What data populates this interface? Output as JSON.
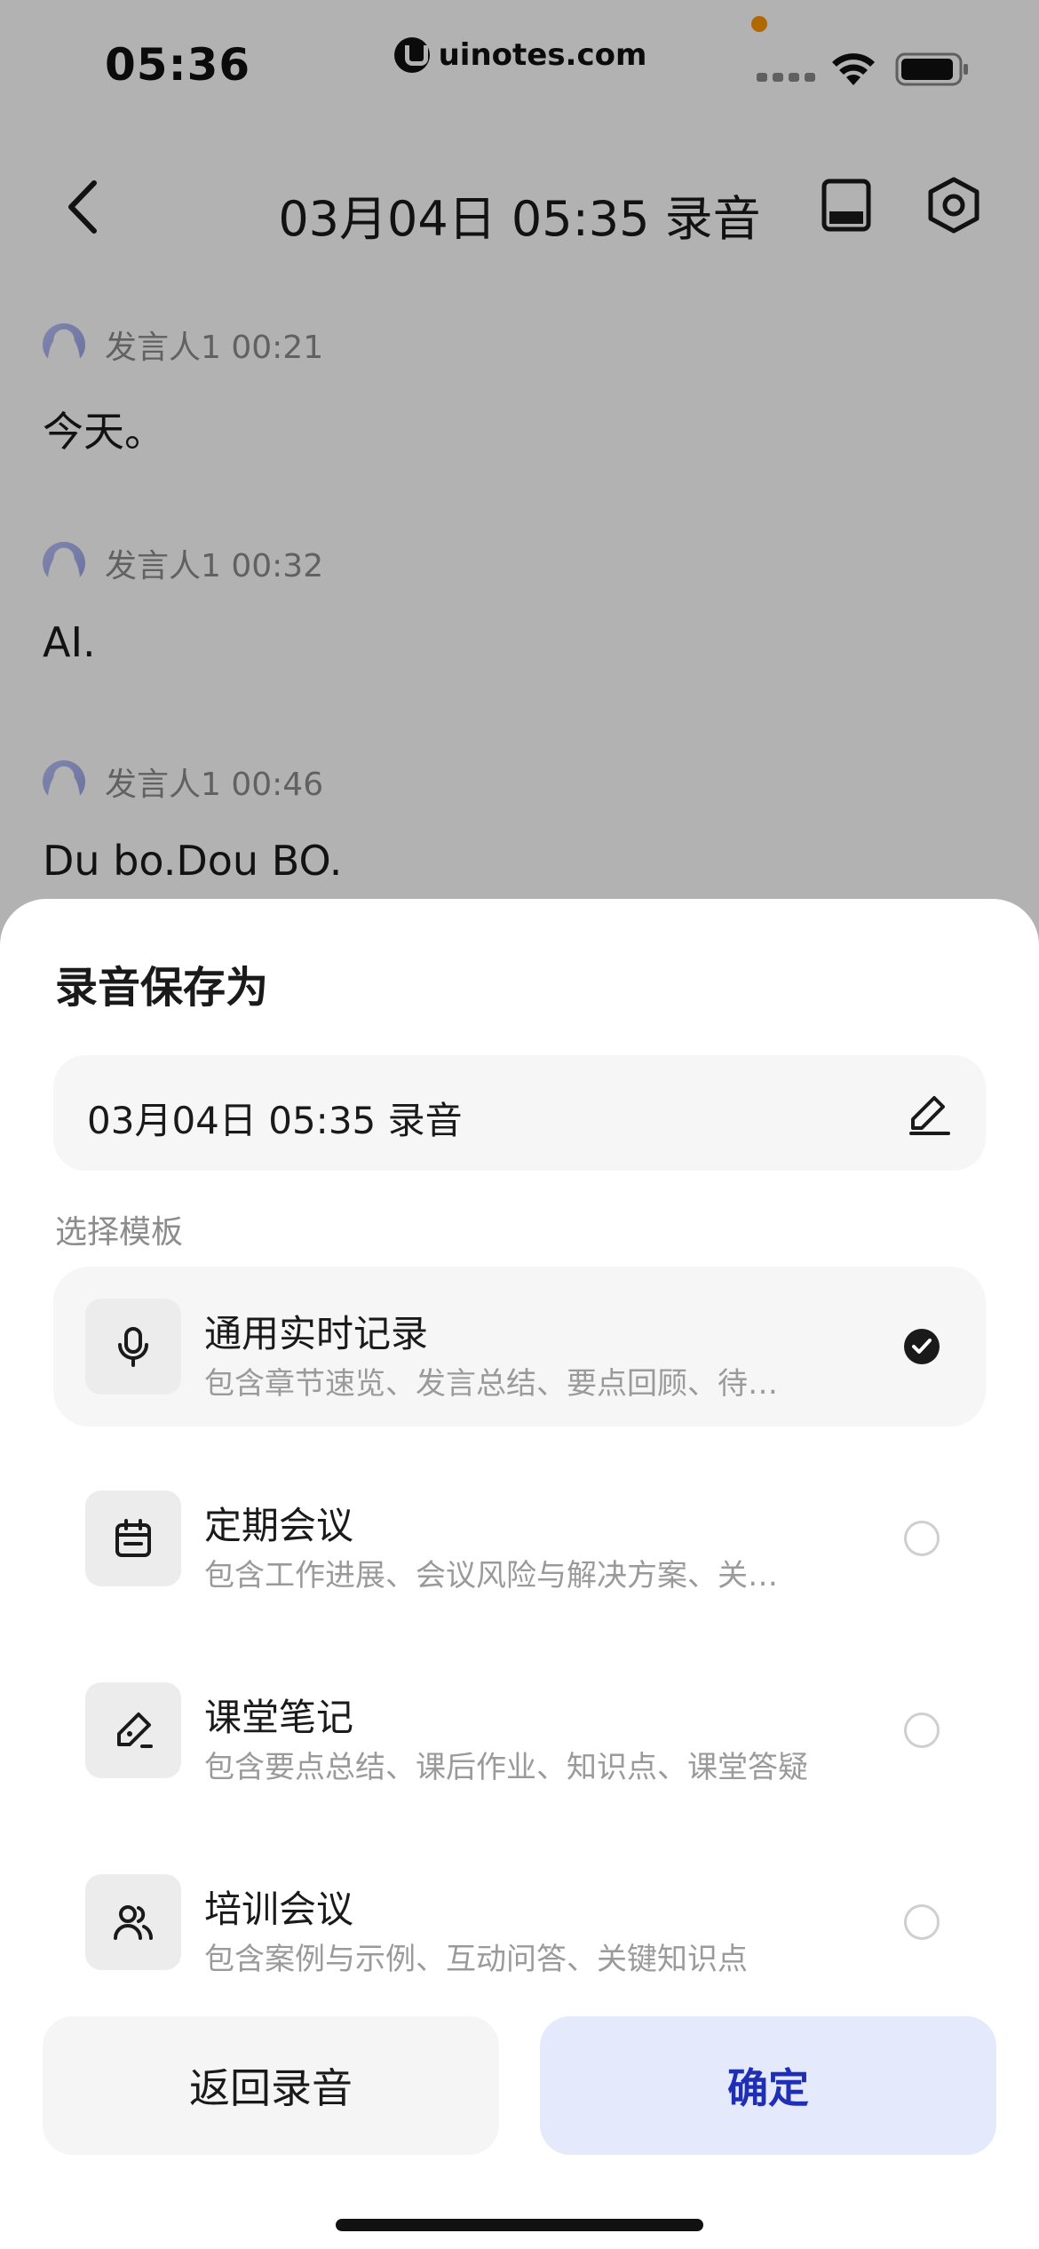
{
  "status_bar": {
    "time": "05:36",
    "url": "uinotes.com",
    "icons": [
      "cellular-signal-icon",
      "wifi-icon",
      "battery-icon"
    ]
  },
  "nav": {
    "title": "03月04日 05:35 录音",
    "icons": [
      "back-icon",
      "subtitle-panel-icon",
      "settings-icon"
    ]
  },
  "transcript": [
    {
      "speaker": "发言人1 00:21",
      "text": "今天。"
    },
    {
      "speaker": "发言人1 00:32",
      "text": "AI."
    },
    {
      "speaker": "发言人1 00:46",
      "text": "Du bo.Dou BO."
    }
  ],
  "sheet": {
    "title": "录音保存为",
    "name_value": "03月04日 05:35 录音",
    "section_label": "选择模板",
    "templates": [
      {
        "name": "通用实时记录",
        "desc": "包含章节速览、发言总结、要点回顾、待…",
        "icon": "microphone-icon",
        "selected": true
      },
      {
        "name": "定期会议",
        "desc": "包含工作进展、会议风险与解决方案、关…",
        "icon": "calendar-icon",
        "selected": false
      },
      {
        "name": "课堂笔记",
        "desc": "包含要点总结、课后作业、知识点、课堂答疑",
        "icon": "pen-icon",
        "selected": false
      },
      {
        "name": "培训会议",
        "desc": "包含案例与示例、互动问答、关键知识点",
        "icon": "people-icon",
        "selected": false
      }
    ],
    "back_button": "返回录音",
    "confirm_button": "确定"
  },
  "colors": {
    "accent_text": "#1f2fb5",
    "accent_bg": "#e4e9fb",
    "overlay": "rgba(0,0,0,0.30)",
    "status_orange": "#ff9500"
  }
}
